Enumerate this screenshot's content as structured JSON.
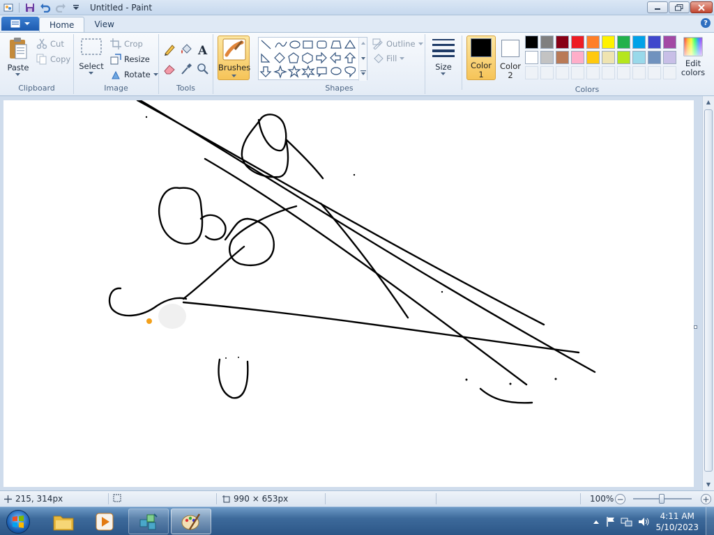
{
  "window": {
    "title": "Untitled - Paint",
    "controls": [
      "minimize-icon",
      "maximize-icon",
      "close-icon"
    ]
  },
  "tabs": [
    {
      "label": "Home",
      "active": true
    },
    {
      "label": "View",
      "active": false
    }
  ],
  "ribbon": {
    "clipboard": {
      "label": "Clipboard",
      "paste": "Paste",
      "cut": "Cut",
      "copy": "Copy"
    },
    "image": {
      "label": "Image",
      "select": "Select",
      "crop": "Crop",
      "resize": "Resize",
      "rotate": "Rotate"
    },
    "tools": {
      "label": "Tools",
      "items": [
        "pencil-icon",
        "fill-bucket-icon",
        "text-icon",
        "eraser-icon",
        "color-picker-icon",
        "magnifier-icon"
      ]
    },
    "brushes": {
      "label": "Brushes"
    },
    "shapes": {
      "label": "Shapes",
      "outline": "Outline",
      "fill": "Fill"
    },
    "size": {
      "label": "Size"
    },
    "color1": {
      "line1": "Color",
      "line2": "1",
      "value": "#000000"
    },
    "color2": {
      "line1": "Color",
      "line2": "2",
      "value": "#ffffff"
    },
    "colors": {
      "label": "Colors",
      "edit_line1": "Edit",
      "edit_line2": "colors",
      "row1": [
        "#000000",
        "#7f7f7f",
        "#880015",
        "#ed1c24",
        "#ff7f27",
        "#fff200",
        "#22b14c",
        "#00a2e8",
        "#3f48cc",
        "#a349a4"
      ],
      "row2": [
        "#ffffff",
        "#c3c3c3",
        "#b97a57",
        "#ffaec9",
        "#ffc90e",
        "#efe4b0",
        "#b5e61d",
        "#99d9ea",
        "#7092be",
        "#c8bfe7"
      ],
      "row3": [
        "#eef2f7",
        "#eef2f7",
        "#eef2f7",
        "#eef2f7",
        "#eef2f7",
        "#eef2f7",
        "#eef2f7",
        "#eef2f7",
        "#eef2f7",
        "#eef2f7"
      ]
    }
  },
  "status": {
    "cursor_position": "215, 314px",
    "canvas_size": "990 × 653px",
    "zoom": "100%",
    "zoom_level": 1.0
  },
  "taskbar": {
    "time": "4:11 AM",
    "date": "5/10/2023",
    "pinned": [
      "explorer-icon",
      "media-player-icon",
      "network-app-icon",
      "paint-icon"
    ]
  }
}
